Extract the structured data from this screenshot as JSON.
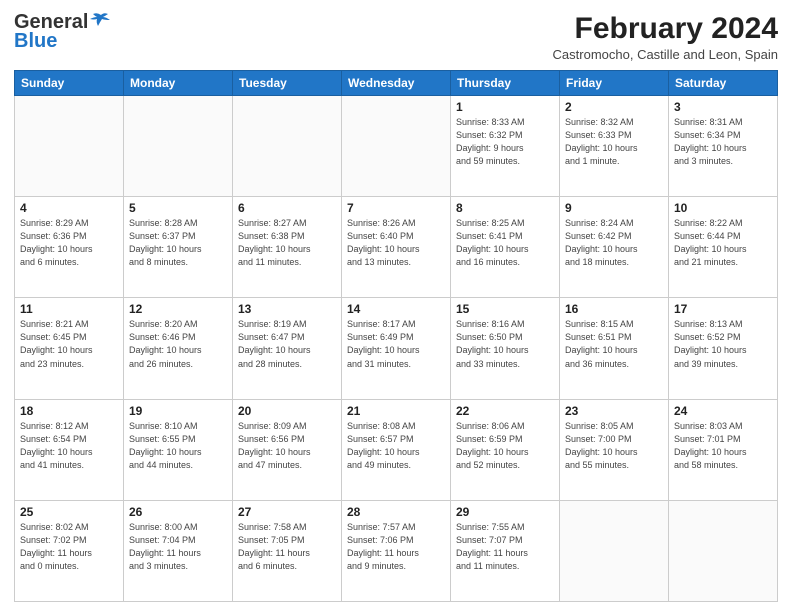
{
  "logo": {
    "line1": "General",
    "line2": "Blue"
  },
  "header": {
    "month": "February 2024",
    "location": "Castromocho, Castille and Leon, Spain"
  },
  "weekdays": [
    "Sunday",
    "Monday",
    "Tuesday",
    "Wednesday",
    "Thursday",
    "Friday",
    "Saturday"
  ],
  "weeks": [
    [
      {
        "day": "",
        "info": ""
      },
      {
        "day": "",
        "info": ""
      },
      {
        "day": "",
        "info": ""
      },
      {
        "day": "",
        "info": ""
      },
      {
        "day": "1",
        "info": "Sunrise: 8:33 AM\nSunset: 6:32 PM\nDaylight: 9 hours\nand 59 minutes."
      },
      {
        "day": "2",
        "info": "Sunrise: 8:32 AM\nSunset: 6:33 PM\nDaylight: 10 hours\nand 1 minute."
      },
      {
        "day": "3",
        "info": "Sunrise: 8:31 AM\nSunset: 6:34 PM\nDaylight: 10 hours\nand 3 minutes."
      }
    ],
    [
      {
        "day": "4",
        "info": "Sunrise: 8:29 AM\nSunset: 6:36 PM\nDaylight: 10 hours\nand 6 minutes."
      },
      {
        "day": "5",
        "info": "Sunrise: 8:28 AM\nSunset: 6:37 PM\nDaylight: 10 hours\nand 8 minutes."
      },
      {
        "day": "6",
        "info": "Sunrise: 8:27 AM\nSunset: 6:38 PM\nDaylight: 10 hours\nand 11 minutes."
      },
      {
        "day": "7",
        "info": "Sunrise: 8:26 AM\nSunset: 6:40 PM\nDaylight: 10 hours\nand 13 minutes."
      },
      {
        "day": "8",
        "info": "Sunrise: 8:25 AM\nSunset: 6:41 PM\nDaylight: 10 hours\nand 16 minutes."
      },
      {
        "day": "9",
        "info": "Sunrise: 8:24 AM\nSunset: 6:42 PM\nDaylight: 10 hours\nand 18 minutes."
      },
      {
        "day": "10",
        "info": "Sunrise: 8:22 AM\nSunset: 6:44 PM\nDaylight: 10 hours\nand 21 minutes."
      }
    ],
    [
      {
        "day": "11",
        "info": "Sunrise: 8:21 AM\nSunset: 6:45 PM\nDaylight: 10 hours\nand 23 minutes."
      },
      {
        "day": "12",
        "info": "Sunrise: 8:20 AM\nSunset: 6:46 PM\nDaylight: 10 hours\nand 26 minutes."
      },
      {
        "day": "13",
        "info": "Sunrise: 8:19 AM\nSunset: 6:47 PM\nDaylight: 10 hours\nand 28 minutes."
      },
      {
        "day": "14",
        "info": "Sunrise: 8:17 AM\nSunset: 6:49 PM\nDaylight: 10 hours\nand 31 minutes."
      },
      {
        "day": "15",
        "info": "Sunrise: 8:16 AM\nSunset: 6:50 PM\nDaylight: 10 hours\nand 33 minutes."
      },
      {
        "day": "16",
        "info": "Sunrise: 8:15 AM\nSunset: 6:51 PM\nDaylight: 10 hours\nand 36 minutes."
      },
      {
        "day": "17",
        "info": "Sunrise: 8:13 AM\nSunset: 6:52 PM\nDaylight: 10 hours\nand 39 minutes."
      }
    ],
    [
      {
        "day": "18",
        "info": "Sunrise: 8:12 AM\nSunset: 6:54 PM\nDaylight: 10 hours\nand 41 minutes."
      },
      {
        "day": "19",
        "info": "Sunrise: 8:10 AM\nSunset: 6:55 PM\nDaylight: 10 hours\nand 44 minutes."
      },
      {
        "day": "20",
        "info": "Sunrise: 8:09 AM\nSunset: 6:56 PM\nDaylight: 10 hours\nand 47 minutes."
      },
      {
        "day": "21",
        "info": "Sunrise: 8:08 AM\nSunset: 6:57 PM\nDaylight: 10 hours\nand 49 minutes."
      },
      {
        "day": "22",
        "info": "Sunrise: 8:06 AM\nSunset: 6:59 PM\nDaylight: 10 hours\nand 52 minutes."
      },
      {
        "day": "23",
        "info": "Sunrise: 8:05 AM\nSunset: 7:00 PM\nDaylight: 10 hours\nand 55 minutes."
      },
      {
        "day": "24",
        "info": "Sunrise: 8:03 AM\nSunset: 7:01 PM\nDaylight: 10 hours\nand 58 minutes."
      }
    ],
    [
      {
        "day": "25",
        "info": "Sunrise: 8:02 AM\nSunset: 7:02 PM\nDaylight: 11 hours\nand 0 minutes."
      },
      {
        "day": "26",
        "info": "Sunrise: 8:00 AM\nSunset: 7:04 PM\nDaylight: 11 hours\nand 3 minutes."
      },
      {
        "day": "27",
        "info": "Sunrise: 7:58 AM\nSunset: 7:05 PM\nDaylight: 11 hours\nand 6 minutes."
      },
      {
        "day": "28",
        "info": "Sunrise: 7:57 AM\nSunset: 7:06 PM\nDaylight: 11 hours\nand 9 minutes."
      },
      {
        "day": "29",
        "info": "Sunrise: 7:55 AM\nSunset: 7:07 PM\nDaylight: 11 hours\nand 11 minutes."
      },
      {
        "day": "",
        "info": ""
      },
      {
        "day": "",
        "info": ""
      }
    ]
  ]
}
